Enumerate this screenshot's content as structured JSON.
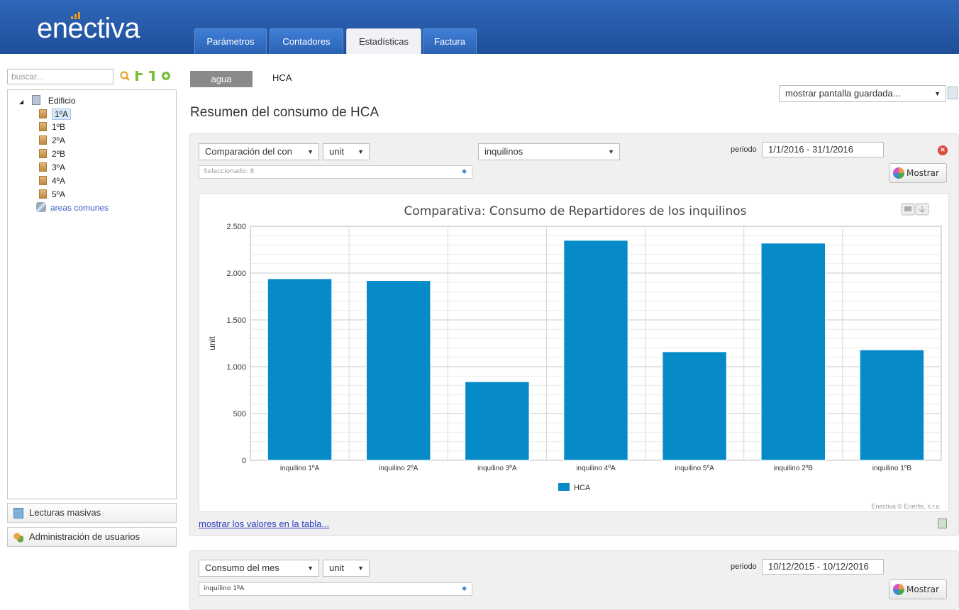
{
  "header": {
    "logo_text": "enectiva",
    "tabs": [
      "Parámetros",
      "Contadores",
      "Estadísticas",
      "Factura"
    ],
    "active_tab": "Estadísticas"
  },
  "sidebar": {
    "search_placeholder": "buscar...",
    "tree_root": "Edificio",
    "tree_items": [
      "1ºA",
      "1ºB",
      "2ºA",
      "2ºB",
      "3ºA",
      "4ºA",
      "5ºA"
    ],
    "selected_item": "1ºA",
    "common_areas": "areas comunes",
    "bulk_readings": "Lecturas masivas",
    "user_admin": "Administración de usuarios"
  },
  "main": {
    "subtabs": [
      "agua",
      "HCA"
    ],
    "title": "Resumen del consumo de HCA",
    "saved_screen_select": "mostrar pantalla guardada...",
    "panel1": {
      "type_select": "Comparación del con",
      "unit_select": "unit",
      "group_select": "inquilinos",
      "selection_placeholder": "Seleccionado: 8",
      "periodo_label": "periodo",
      "periodo_value": "1/1/2016 - 31/1/2016",
      "show_button": "Mostrar",
      "table_link": "mostrar los valores en la tabla..."
    },
    "panel2": {
      "type_select": "Consumo del mes",
      "unit_select": "unit",
      "tenant_select": "inquilino 1ºA",
      "periodo_label": "periodo",
      "periodo_value": "10/12/2015 - 10/12/2016",
      "show_button": "Mostrar"
    }
  },
  "chart_data": {
    "type": "bar",
    "title": "Comparativa: Consumo de Repartidores de los inquilinos",
    "ylabel": "unit",
    "categories": [
      "inquilino 1ºA",
      "inquilino 2ºA",
      "inquilino 3ºA",
      "inquilino 4ºA",
      "inquilino 5ºA",
      "inquilino 2ºB",
      "inquilino 1ºB"
    ],
    "series": [
      {
        "name": "HCA",
        "values": [
          1940,
          1920,
          840,
          2350,
          1160,
          2320,
          1180
        ]
      }
    ],
    "ylim": [
      0,
      2500
    ],
    "yticks": [
      "0",
      "500",
      "1.000",
      "1.500",
      "2.000",
      "2.500"
    ],
    "grid": true,
    "legend": "bottom",
    "credit": "Enectiva © Enerfis, s.r.o.",
    "bar_color": "#078bc8"
  }
}
